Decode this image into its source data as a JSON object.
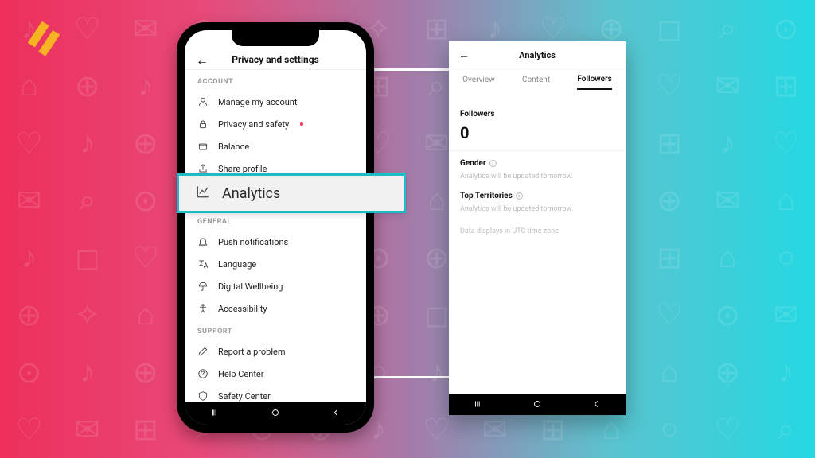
{
  "settings_screen": {
    "title": "Privacy and settings",
    "sections": {
      "account_label": "ACCOUNT",
      "general_label": "GENERAL",
      "support_label": "SUPPORT"
    },
    "items": {
      "manage_account": "Manage my account",
      "privacy_safety": "Privacy and safety",
      "balance": "Balance",
      "share_profile": "Share profile",
      "analytics": "Analytics",
      "push_notifications": "Push notifications",
      "language": "Language",
      "digital_wellbeing": "Digital Wellbeing",
      "accessibility": "Accessibility",
      "report_problem": "Report a problem",
      "help_center": "Help Center",
      "safety_center": "Safety Center"
    }
  },
  "analytics_screen": {
    "title": "Analytics",
    "tabs": {
      "overview": "Overview",
      "content": "Content",
      "followers": "Followers"
    },
    "followers_label": "Followers",
    "followers_count": "0",
    "gender_label": "Gender",
    "territories_label": "Top Territories",
    "update_msg": "Analytics will be updated tomorrow.",
    "utc_note": "Data displays in UTC time zone"
  },
  "callout": {
    "label": "Analytics"
  }
}
